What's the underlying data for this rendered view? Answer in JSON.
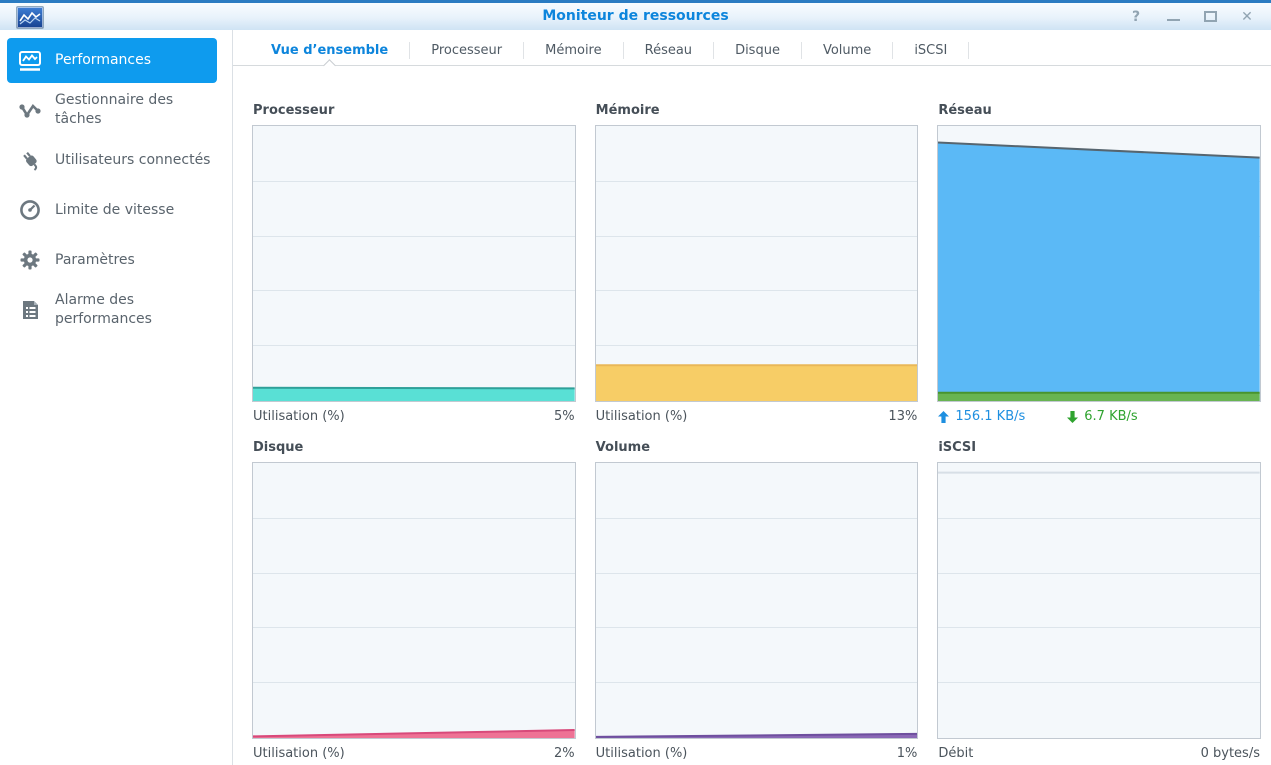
{
  "window": {
    "title": "Moniteur de ressources",
    "controls": {
      "help": "?",
      "close": "✕"
    }
  },
  "colors": {
    "accent_blue": "#0d85dc",
    "selected_item_bg": "#0e9bee",
    "chart_bg": "#f4f8fb",
    "chart_border": "#c2c9d1",
    "gridline": "#dde5eb"
  },
  "sidebar": {
    "items": [
      {
        "label": "Performances",
        "icon": "performance-chart-icon",
        "selected": true
      },
      {
        "label": "Gestionnaire des tâches",
        "icon": "task-manager-icon",
        "selected": false
      },
      {
        "label": "Utilisateurs connectés",
        "icon": "connected-users-plug-icon",
        "selected": false
      },
      {
        "label": "Limite de vitesse",
        "icon": "speed-limit-gauge-icon",
        "selected": false
      },
      {
        "label": "Paramètres",
        "icon": "settings-gear-icon",
        "selected": false
      },
      {
        "label": "Alarme des performances",
        "icon": "performance-alarm-icon",
        "selected": false
      }
    ]
  },
  "tabs": [
    {
      "label": "Vue d’ensemble",
      "active": true
    },
    {
      "label": "Processeur",
      "active": false
    },
    {
      "label": "Mémoire",
      "active": false
    },
    {
      "label": "Réseau",
      "active": false
    },
    {
      "label": "Disque",
      "active": false
    },
    {
      "label": "Volume",
      "active": false
    },
    {
      "label": "iSCSI",
      "active": false
    }
  ],
  "panels": [
    {
      "key": "processeur",
      "title": "Processeur",
      "areas": [
        {
          "name": "cpu-usage-area",
          "left_pct": 4.8,
          "right_pct": 4.6,
          "fill": "#59e0d5",
          "stroke": "#2fa099"
        }
      ],
      "footer": {
        "label": "Utilisation (%)",
        "value": "5%"
      }
    },
    {
      "key": "memoire",
      "title": "Mémoire",
      "areas": [
        {
          "name": "memory-usage-area",
          "left_pct": 13,
          "right_pct": 13,
          "fill": "#f7cd66",
          "stroke": "#e9b758"
        }
      ],
      "footer": {
        "label": "Utilisation (%)",
        "value": "13%"
      }
    },
    {
      "key": "reseau",
      "title": "Réseau",
      "areas": [
        {
          "name": "network-upload-area",
          "left_pct": 94,
          "right_pct": 88.5,
          "fill": "#5bb9f6",
          "stroke": "#56656f"
        },
        {
          "name": "network-download-area",
          "left_pct": 3,
          "right_pct": 3,
          "fill": "#68b451",
          "stroke": "#48942f"
        }
      ],
      "footer": {
        "upload": {
          "value": "156.1 KB/s",
          "color": "#1e8fe0",
          "icon": "up-arrow-icon"
        },
        "download": {
          "value": "6.7 KB/s",
          "color": "#2fa32f",
          "icon": "down-arrow-icon"
        }
      }
    },
    {
      "key": "disque",
      "title": "Disque",
      "areas": [
        {
          "name": "disk-usage-area",
          "left_pct": 0.6,
          "right_pct": 2.9,
          "fill": "#ee7295",
          "stroke": "#d8497a"
        }
      ],
      "footer": {
        "label": "Utilisation (%)",
        "value": "2%"
      }
    },
    {
      "key": "volume",
      "title": "Volume",
      "areas": [
        {
          "name": "volume-usage-area",
          "left_pct": 0.4,
          "right_pct": 1.5,
          "fill": "#8a68b6",
          "stroke": "#6e4f9e"
        }
      ],
      "footer": {
        "label": "Utilisation (%)",
        "value": "1%"
      }
    },
    {
      "key": "iscsi",
      "title": "iSCSI",
      "areas": [
        {
          "name": "iscsi-zero-line",
          "left_pct": 96.5,
          "right_pct": 96.5,
          "fill": "none",
          "stroke": "#d7dfe6"
        }
      ],
      "footer": {
        "label": "Débit",
        "value": "0 bytes/s"
      }
    }
  ]
}
